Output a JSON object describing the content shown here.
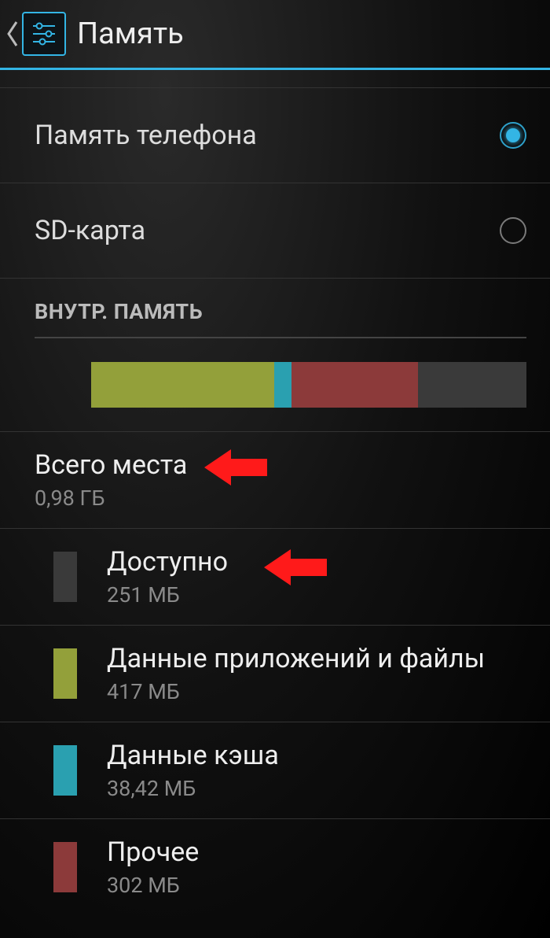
{
  "header": {
    "title": "Память"
  },
  "options": {
    "phone_storage": {
      "label": "Память телефона",
      "selected": true
    },
    "sd_card": {
      "label": "SD-карта",
      "selected": false
    }
  },
  "section_internal": {
    "header": "ВНУТР. ПАМЯТЬ"
  },
  "storage": {
    "total": {
      "label": "Всего места",
      "value": "0,98 ГБ"
    },
    "available": {
      "label": "Доступно",
      "value": "251 МБ"
    },
    "apps": {
      "label": "Данные приложений и файлы",
      "value": "417 МБ"
    },
    "cache": {
      "label": "Данные кэша",
      "value": "38,42 МБ"
    },
    "other": {
      "label": "Прочее",
      "value": "302 МБ"
    },
    "bar_percent": {
      "apps": 42,
      "cache": 4,
      "other": 29,
      "free": 25
    }
  }
}
